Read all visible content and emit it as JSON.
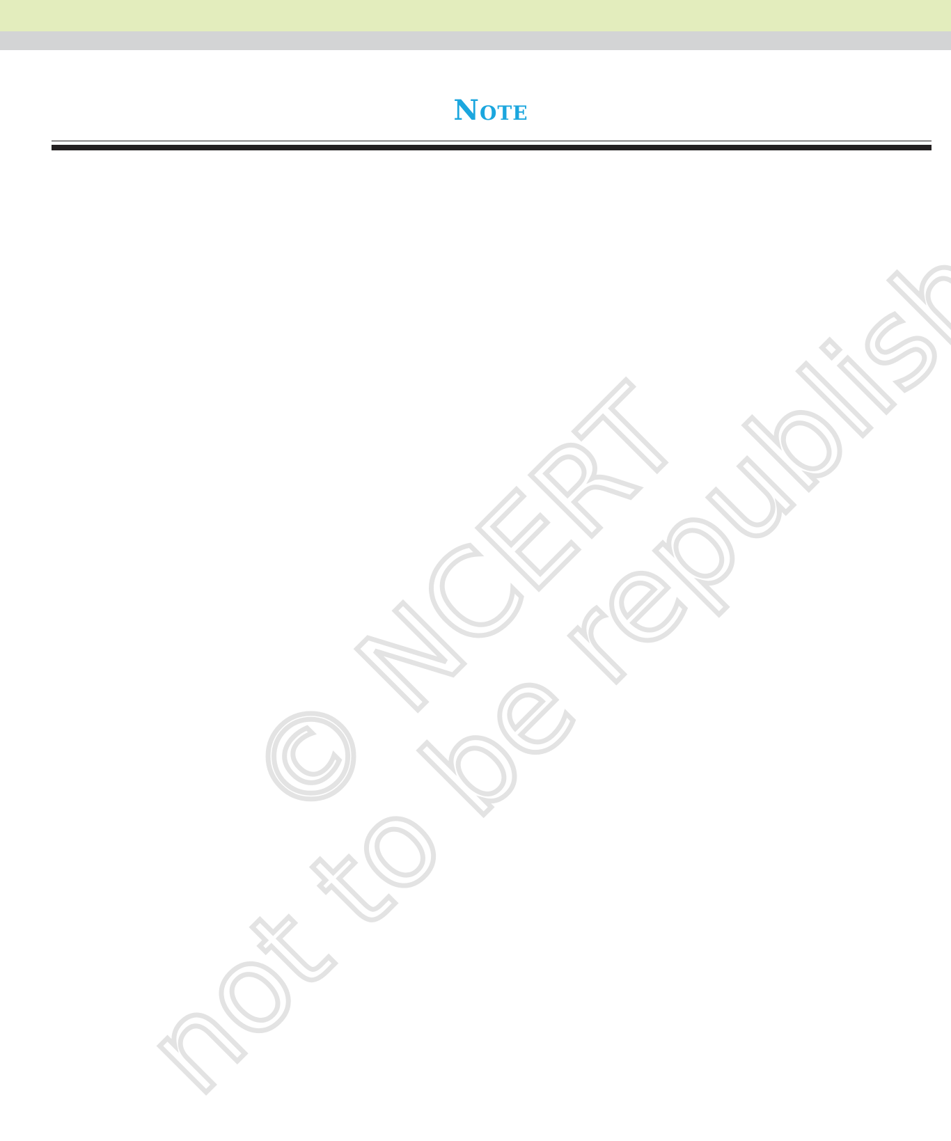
{
  "page": {
    "heading": "Note"
  },
  "watermark": {
    "line1": "© NCERT",
    "line2": "not to be republished"
  },
  "colors": {
    "top_band": "#e3edbd",
    "grey_band": "#d3d4d5",
    "heading": "#1ba6de",
    "rules": "#231f20",
    "watermark": "#e3e3e3"
  }
}
